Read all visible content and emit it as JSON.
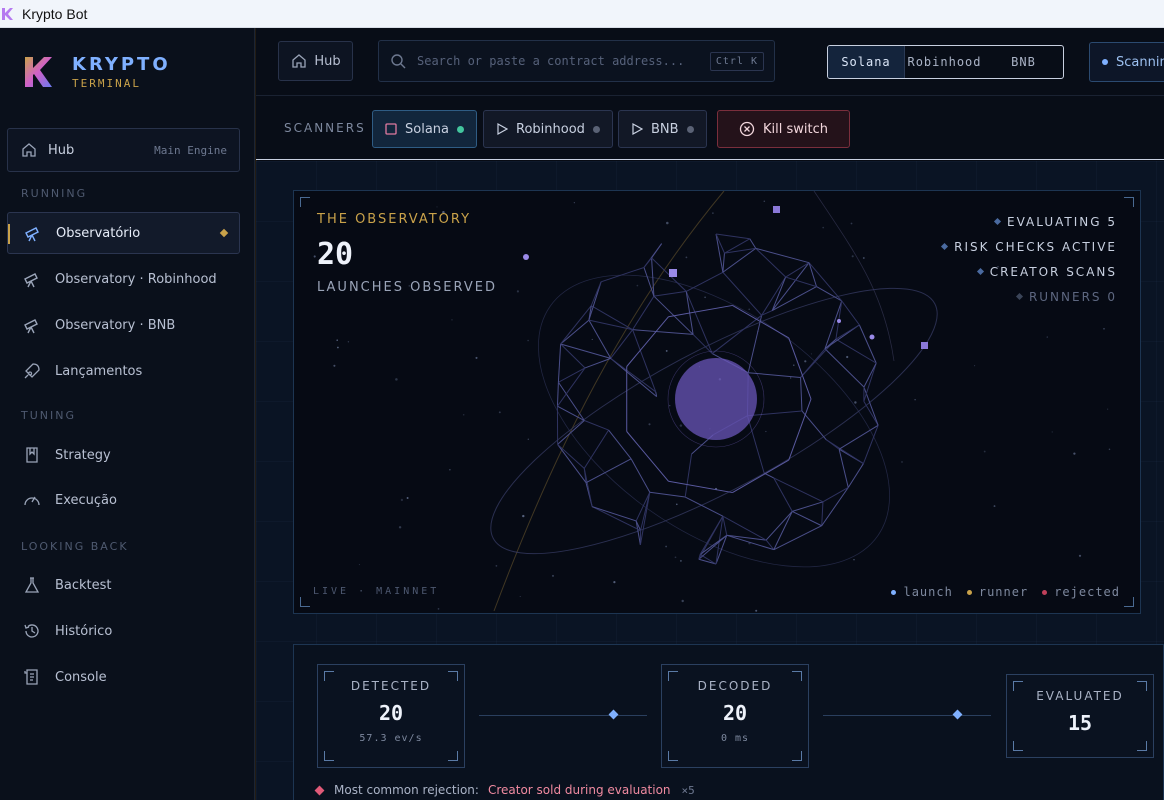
{
  "window": {
    "title": "Krypto Bot"
  },
  "brand": {
    "title": "KRYPTO",
    "subtitle": "TERMINAL"
  },
  "sidebar": {
    "hub": {
      "label": "Hub",
      "sub": "Main Engine"
    },
    "sections": {
      "running": "RUNNING",
      "tuning": "TUNING",
      "looking_back": "LOOKING BACK"
    },
    "items": [
      {
        "label": "Observatório",
        "icon": "telescope-icon"
      },
      {
        "label": "Observatory · Robinhood",
        "icon": "telescope-icon"
      },
      {
        "label": "Observatory · BNB",
        "icon": "telescope-icon"
      },
      {
        "label": "Lançamentos",
        "icon": "rocket-icon"
      },
      {
        "label": "Strategy",
        "icon": "book-icon"
      },
      {
        "label": "Execução",
        "icon": "gauge-icon"
      },
      {
        "label": "Backtest",
        "icon": "flask-icon"
      },
      {
        "label": "Histórico",
        "icon": "history-icon"
      },
      {
        "label": "Console",
        "icon": "console-icon"
      }
    ]
  },
  "topbar": {
    "hub_label": "Hub",
    "search_placeholder": "Search or paste a contract address...",
    "shortcut": "Ctrl K",
    "chains": [
      "Solana",
      "Robinhood",
      "BNB"
    ],
    "selected_chain": "Solana",
    "scanning_label": "Scanning"
  },
  "scanners": {
    "title": "SCANNERS",
    "chips": [
      {
        "label": "Solana",
        "running": true
      },
      {
        "label": "Robinhood",
        "running": false
      },
      {
        "label": "BNB",
        "running": false
      }
    ],
    "kill_label": "Kill switch"
  },
  "observatory": {
    "title": "THE OBSERVATORY",
    "count": "20",
    "subtitle": "LAUNCHES OBSERVED",
    "stats": [
      "EVALUATING 5",
      "RISK CHECKS ACTIVE",
      "CREATOR SCANS",
      "RUNNERS 0"
    ],
    "footer": "LIVE · MAINNET",
    "legend": [
      {
        "label": "launch",
        "color": "#7fb0ff"
      },
      {
        "label": "runner",
        "color": "#c9a24a"
      },
      {
        "label": "rejected",
        "color": "#c0405a"
      }
    ]
  },
  "pipeline": {
    "stages": [
      {
        "name": "DETECTED",
        "value": "20",
        "rate": "57.3 ev/s"
      },
      {
        "name": "DECODED",
        "value": "20",
        "rate": "0 ms"
      },
      {
        "name": "EVALUATED",
        "value": "15",
        "rate": ""
      }
    ],
    "rejection_label": "Most common rejection:",
    "rejection_value": "Creator sold during evaluation",
    "rejection_count": "×5"
  },
  "colors": {
    "accent": "#7fb0ff",
    "gold": "#c9a24a",
    "danger": "#e05a78",
    "running": "#43c59e"
  }
}
